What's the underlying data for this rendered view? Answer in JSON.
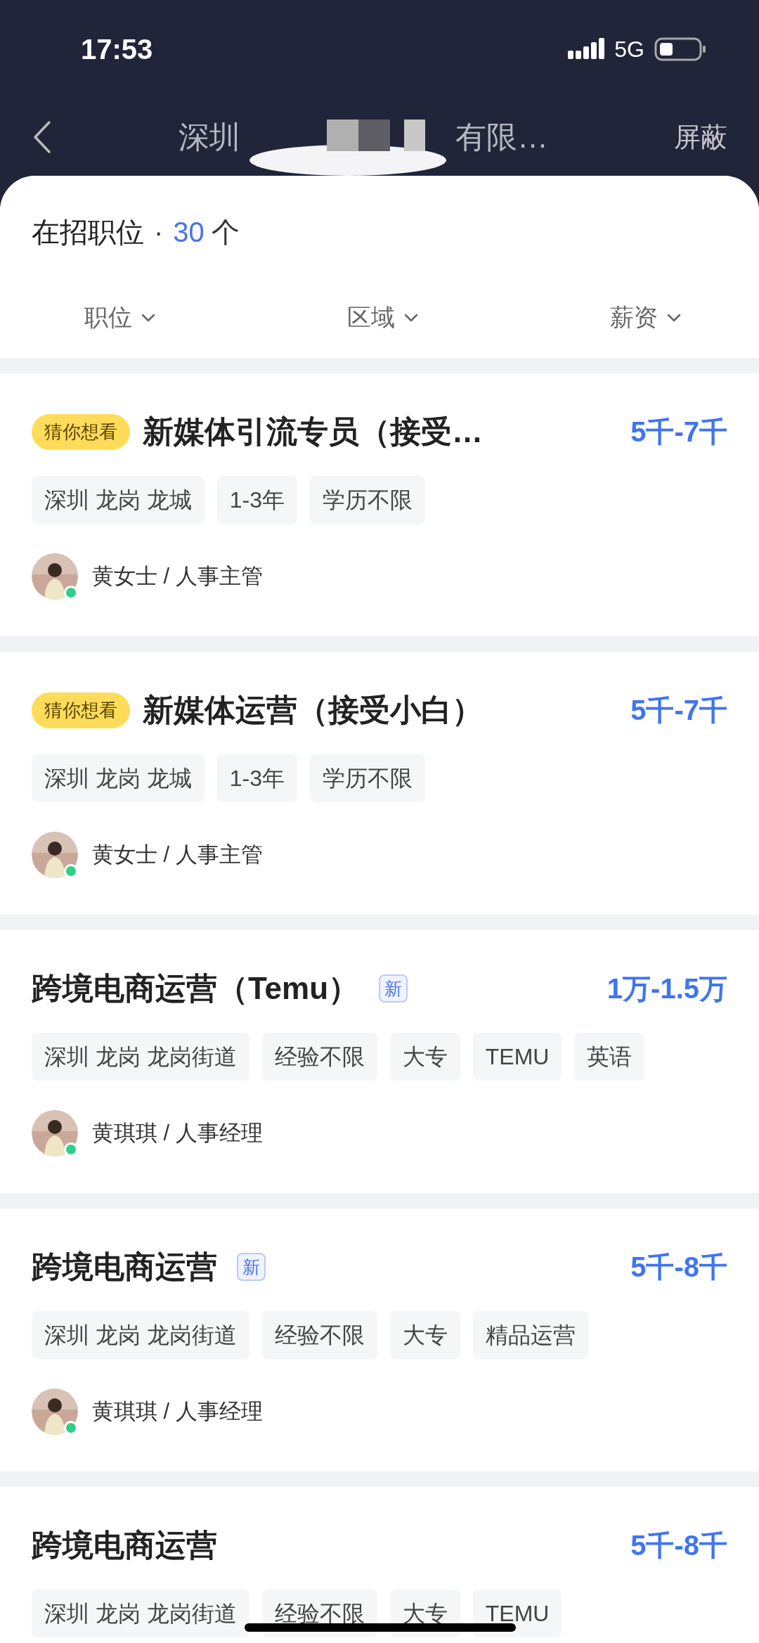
{
  "status_bar": {
    "time": "17:53",
    "network": "5G"
  },
  "nav": {
    "title_start": "深圳",
    "title_end": "有限…",
    "action": "屏蔽"
  },
  "header": {
    "label": "在招职位",
    "separator": "·",
    "count": "30",
    "unit": "个"
  },
  "filters": [
    {
      "label": "职位"
    },
    {
      "label": "区域"
    },
    {
      "label": "薪资"
    }
  ],
  "jobs": [
    {
      "badge": "猜你想看",
      "title": "新媒体引流专员（接受…",
      "new": false,
      "salary": "5千-7千",
      "tags": [
        "深圳 龙岗 龙城",
        "1-3年",
        "学历不限"
      ],
      "recruiter": {
        "text": "黄女士 / 人事主管",
        "online": true
      }
    },
    {
      "badge": "猜你想看",
      "title": "新媒体运营（接受小白）",
      "new": false,
      "salary": "5千-7千",
      "tags": [
        "深圳 龙岗 龙城",
        "1-3年",
        "学历不限"
      ],
      "recruiter": {
        "text": "黄女士 / 人事主管",
        "online": true
      }
    },
    {
      "title": "跨境电商运营（Temu）",
      "new": true,
      "new_label": "新",
      "salary": "1万-1.5万",
      "tags": [
        "深圳 龙岗 龙岗街道",
        "经验不限",
        "大专",
        "TEMU",
        "英语"
      ],
      "recruiter": {
        "text": "黄琪琪 / 人事经理",
        "online": true
      }
    },
    {
      "title": "跨境电商运营",
      "new": true,
      "new_label": "新",
      "salary": "5千-8千",
      "tags": [
        "深圳 龙岗 龙岗街道",
        "经验不限",
        "大专",
        "精品运营"
      ],
      "recruiter": {
        "text": "黄琪琪 / 人事经理",
        "online": true
      }
    },
    {
      "title": "跨境电商运营",
      "new": false,
      "salary": "5千-8千",
      "tags": [
        "深圳 龙岗 龙岗街道",
        "经验不限",
        "大专",
        "TEMU"
      ]
    }
  ]
}
